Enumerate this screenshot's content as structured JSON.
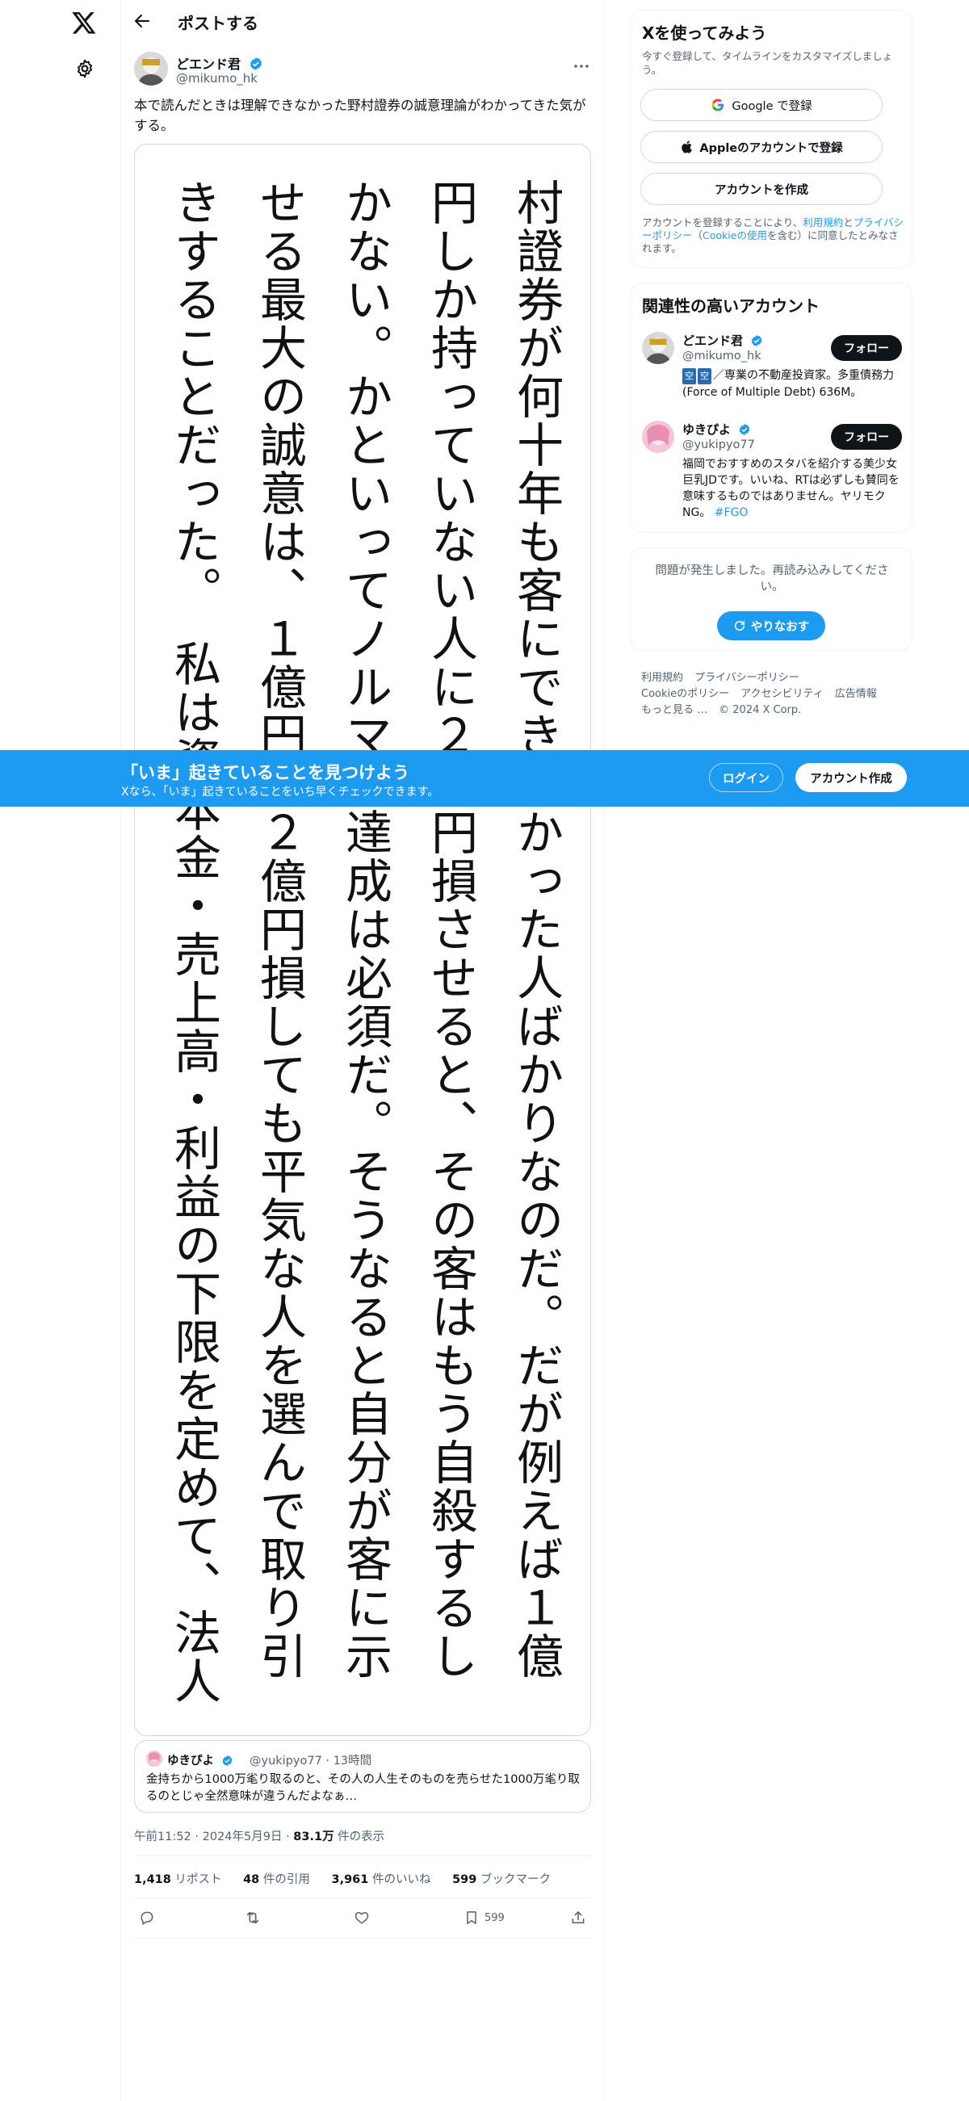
{
  "header": {
    "title": "ポストする"
  },
  "post": {
    "author_name": "どエンド君",
    "author_handle": "@mikumo_hk",
    "text": "本で読んだときは理解できなかった野村證券の誠意理論がわかってきた気がする。",
    "image_columns": [
      "村證券が何十年も客にできなかった人ばかりなのだ。だが例えば１億",
      "円しか持っていない人に２億円損させると、その客はもう自殺するし",
      "かない。かといってノルマの達成は必須だ。そうなると自分が客に示",
      "せる最大の誠意は、１億円、２億円損しても平気な人を選んで取り引",
      "きすることだった。　私は資本金・売上高・利益の下限を定めて、法人"
    ],
    "timestamp": "午前11:52 · 2024年5月9日 · ",
    "views_count": "83.1万",
    "views_label": " 件の表示"
  },
  "quote": {
    "name": "ゆきぴよ",
    "meta": "@yukipyo77 · 13時間",
    "text": "金持ちから1000万毟り取るのと、その人の人生そのものを売らせた1000万毟り取るのとじゃ全然意味が違うんだよなぁ…"
  },
  "stats": {
    "reposts_count": "1,418",
    "reposts_label": " リポスト",
    "quotes_count": "48",
    "quotes_label": " 件の引用",
    "likes_count": "3,961",
    "likes_label": " 件のいいね",
    "bookmarks_count": "599",
    "bookmarks_label": " ブックマーク"
  },
  "actions": {
    "bookmark_count": "599"
  },
  "signup_card": {
    "title": "Xを使ってみよう",
    "desc": "今すぐ登録して、タイムラインをカスタマイズしましょう。",
    "google_label": "Google で登録",
    "apple_label": "Appleのアカウントで登録",
    "create_label": "アカウントを作成",
    "legal_prefix": "アカウントを登録することにより、",
    "legal_terms": "利用規約",
    "legal_and": "と",
    "legal_privacy": "プライバシーポリシー",
    "legal_cookie_pre": "（",
    "legal_cookie": "Cookieの使用",
    "legal_suffix": "を含む）に同意したとみなされます。"
  },
  "relevant": {
    "title": "関連性の高いアカウント",
    "accounts": [
      {
        "name": "どエンド君",
        "handle": "@mikumo_hk",
        "tag1": "空",
        "tag2": "空",
        "bio": "／専業の不動産投資家。多重債務力(Force of Multiple Debt) 636M。",
        "follow": "フォロー"
      },
      {
        "name": "ゆきぴよ",
        "handle": "@yukipyo77",
        "bio": "福岡でおすすめのスタバを紹介する美少女巨乳JDです。いいね、RTは必ずしも賛同を意味するものではありません。ヤリモクNG。",
        "hashtag": "#FGO",
        "follow": "フォロー"
      }
    ]
  },
  "error_card": {
    "message": "問題が発生しました。再読み込みしてください。",
    "retry": "やりなおす"
  },
  "footer": {
    "links": [
      "利用規約",
      "プライバシーポリシー",
      "Cookieのポリシー",
      "アクセシビリティ",
      "広告情報",
      "もっと見る …",
      "© 2024 X Corp."
    ]
  },
  "banner": {
    "title": "「いま」起きていることを見つけよう",
    "subtitle": "Xなら、「いま」起きていることをいち早くチェックできます。",
    "login": "ログイン",
    "signup": "アカウント作成"
  },
  "colors": {
    "accent": "#1d9bf0",
    "text": "#0f1419",
    "secondary": "#536471",
    "border": "#eff3f4"
  }
}
